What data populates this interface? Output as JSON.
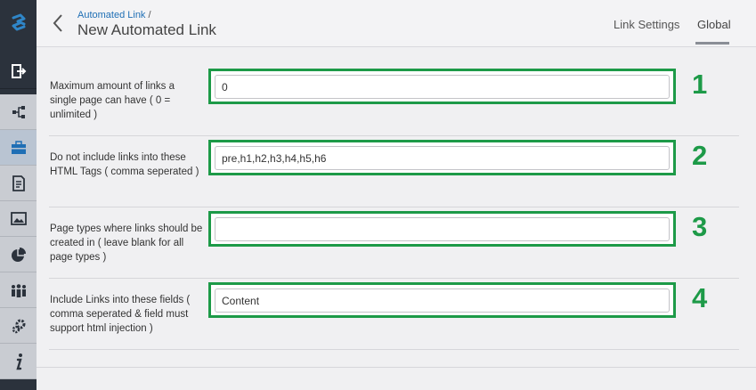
{
  "header": {
    "breadcrumb_link": "Automated Link",
    "breadcrumb_sep": "/",
    "title": "New Automated Link",
    "tabs": [
      {
        "label": "Link Settings"
      },
      {
        "label": "Global"
      }
    ],
    "active_tab": "Global"
  },
  "sidebar": {
    "items": [
      {
        "icon": "logo-icon"
      },
      {
        "icon": "logout-icon"
      },
      {
        "icon": "sitemap-icon"
      },
      {
        "icon": "briefcase-icon",
        "active": true
      },
      {
        "icon": "document-icon"
      },
      {
        "icon": "image-icon"
      },
      {
        "icon": "pie-chart-icon"
      },
      {
        "icon": "users-icon"
      },
      {
        "icon": "settings-icon"
      },
      {
        "icon": "info-icon"
      }
    ]
  },
  "fields": [
    {
      "label": "Maximum amount of links a single page can have ( 0 = unlimited )",
      "value": "0",
      "number": "1"
    },
    {
      "label": "Do not include links into these HTML Tags ( comma seperated )",
      "value": "pre,h1,h2,h3,h4,h5,h6",
      "number": "2"
    },
    {
      "label": "Page types where links should be created in ( leave blank for all page types )",
      "value": "",
      "number": "3"
    },
    {
      "label": "Include Links into these fields ( comma seperated & field must support html injection )",
      "value": "Content",
      "number": "4"
    }
  ],
  "colors": {
    "highlight": "#1d9a48",
    "link": "#1f6fb5",
    "sidebar_dark": "#2b323c"
  }
}
